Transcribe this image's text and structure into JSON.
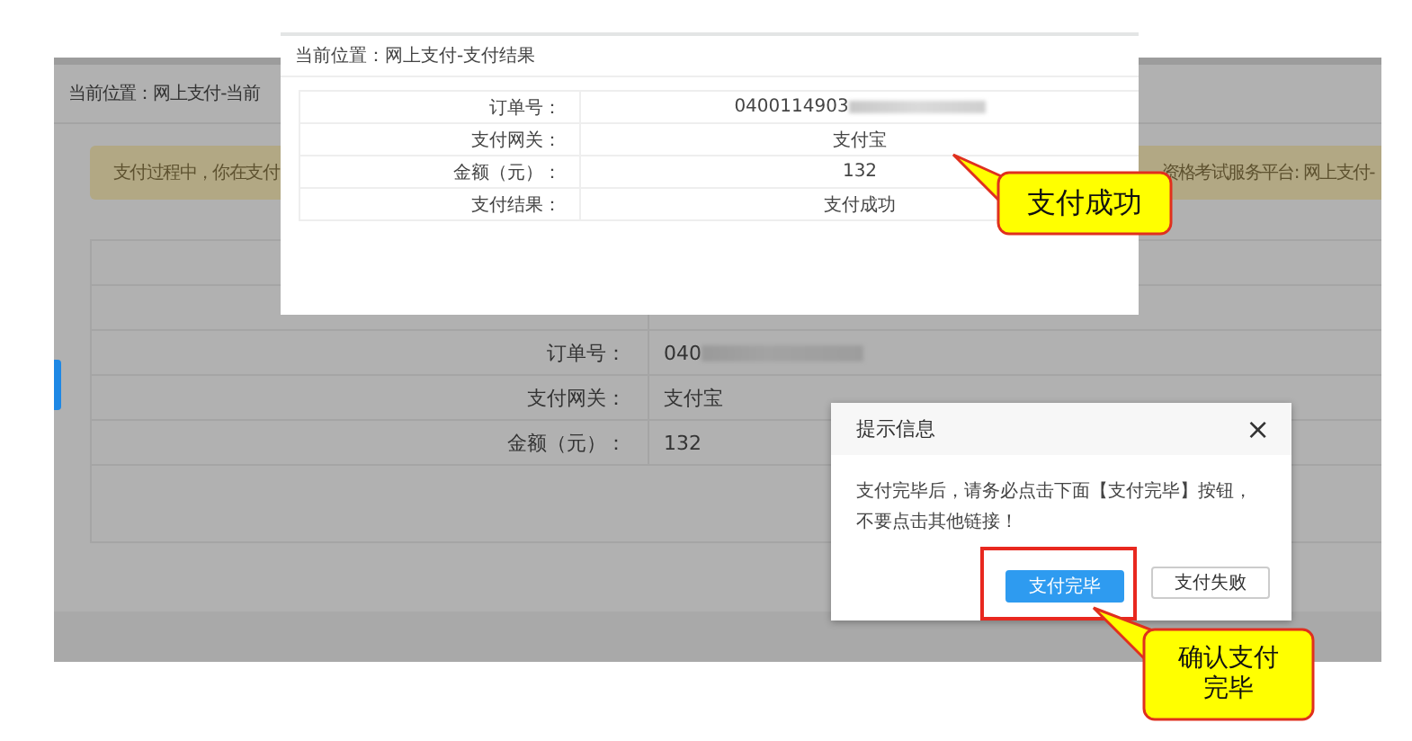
{
  "page": {
    "breadcrumb": "当前位置：网上支付-当前",
    "notice": [
      "支付过程中，你在支付",
      "资格考试服务平台: 网上支付-"
    ],
    "details": [
      {
        "label": "订单号：",
        "value": "040",
        "redacted": true
      },
      {
        "label": "支付网关：",
        "value": "支付宝",
        "redacted": false
      },
      {
        "label": "金额（元）：",
        "value": "132",
        "redacted": false
      }
    ]
  },
  "result_inset": {
    "breadcrumb": "当前位置：网上支付-支付结果",
    "rows": [
      {
        "label": "订单号：",
        "value": "0400114903",
        "redacted": true
      },
      {
        "label": "支付网关：",
        "value": "支付宝",
        "redacted": false
      },
      {
        "label": "金额（元）：",
        "value": "132",
        "redacted": false
      },
      {
        "label": "支付结果：",
        "value": "支付成功",
        "redacted": false
      }
    ]
  },
  "callouts": [
    {
      "text": "支付成功"
    },
    {
      "text": "确认支付完毕"
    }
  ],
  "dialog": {
    "title": "提示信息",
    "close": "×",
    "message": "支付完毕后，请务必点击下面【支付完毕】按钮，不要点击其他链接！",
    "buttons": [
      {
        "label": "支付完毕",
        "kind": "primary",
        "highlighted": true
      },
      {
        "label": "支付失败",
        "kind": "default",
        "highlighted": false
      }
    ]
  }
}
